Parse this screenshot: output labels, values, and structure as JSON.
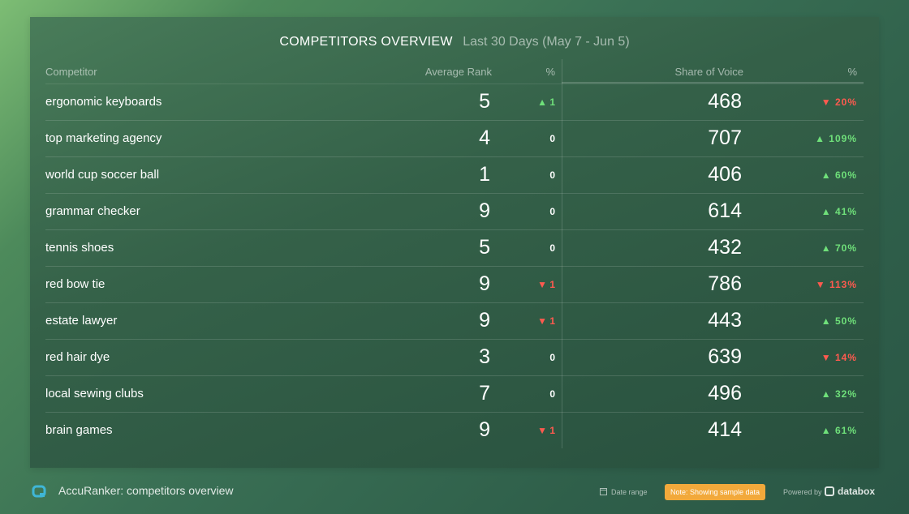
{
  "widget": {
    "title": "COMPETITORS OVERVIEW",
    "subtitle": "Last 30 Days (May 7 - Jun 5)",
    "columns": {
      "competitor": "Competitor",
      "average_rank": "Average Rank",
      "rank_pct": "%",
      "share_of_voice": "Share of Voice",
      "sov_pct": "%"
    },
    "rows": [
      {
        "name": "ergonomic keyboards",
        "rank": "5",
        "rank_change": "1",
        "rank_dir": "up",
        "sov": "468",
        "sov_change": "20%",
        "sov_dir": "down"
      },
      {
        "name": "top marketing agency",
        "rank": "4",
        "rank_change": "0",
        "rank_dir": "flat",
        "sov": "707",
        "sov_change": "109%",
        "sov_dir": "up"
      },
      {
        "name": "world cup soccer ball",
        "rank": "1",
        "rank_change": "0",
        "rank_dir": "flat",
        "sov": "406",
        "sov_change": "60%",
        "sov_dir": "up"
      },
      {
        "name": "grammar checker",
        "rank": "9",
        "rank_change": "0",
        "rank_dir": "flat",
        "sov": "614",
        "sov_change": "41%",
        "sov_dir": "up"
      },
      {
        "name": "tennis shoes",
        "rank": "5",
        "rank_change": "0",
        "rank_dir": "flat",
        "sov": "432",
        "sov_change": "70%",
        "sov_dir": "up"
      },
      {
        "name": "red bow tie",
        "rank": "9",
        "rank_change": "1",
        "rank_dir": "down",
        "sov": "786",
        "sov_change": "113%",
        "sov_dir": "down"
      },
      {
        "name": "estate lawyer",
        "rank": "9",
        "rank_change": "1",
        "rank_dir": "down",
        "sov": "443",
        "sov_change": "50%",
        "sov_dir": "up"
      },
      {
        "name": "red hair dye",
        "rank": "3",
        "rank_change": "0",
        "rank_dir": "flat",
        "sov": "639",
        "sov_change": "14%",
        "sov_dir": "down"
      },
      {
        "name": "local sewing clubs",
        "rank": "7",
        "rank_change": "0",
        "rank_dir": "flat",
        "sov": "496",
        "sov_change": "32%",
        "sov_dir": "up"
      },
      {
        "name": "brain games",
        "rank": "9",
        "rank_change": "1",
        "rank_dir": "down",
        "sov": "414",
        "sov_change": "61%",
        "sov_dir": "up"
      }
    ]
  },
  "footer": {
    "title": "AccuRanker: competitors overview",
    "date_range_label": "Date range",
    "note": "Note: Showing sample data",
    "powered_by": "Powered by",
    "brand": "databox"
  },
  "colors": {
    "up": "#6fe07a",
    "down": "#ff5a4f",
    "note_badge": "#f2a93b",
    "logo": "#3fb6d6"
  },
  "icons": {
    "up": "triangle-up-icon",
    "down": "triangle-down-icon",
    "logo": "accuranker-logo-icon",
    "calendar": "calendar-icon",
    "brand": "databox-logo-icon"
  }
}
